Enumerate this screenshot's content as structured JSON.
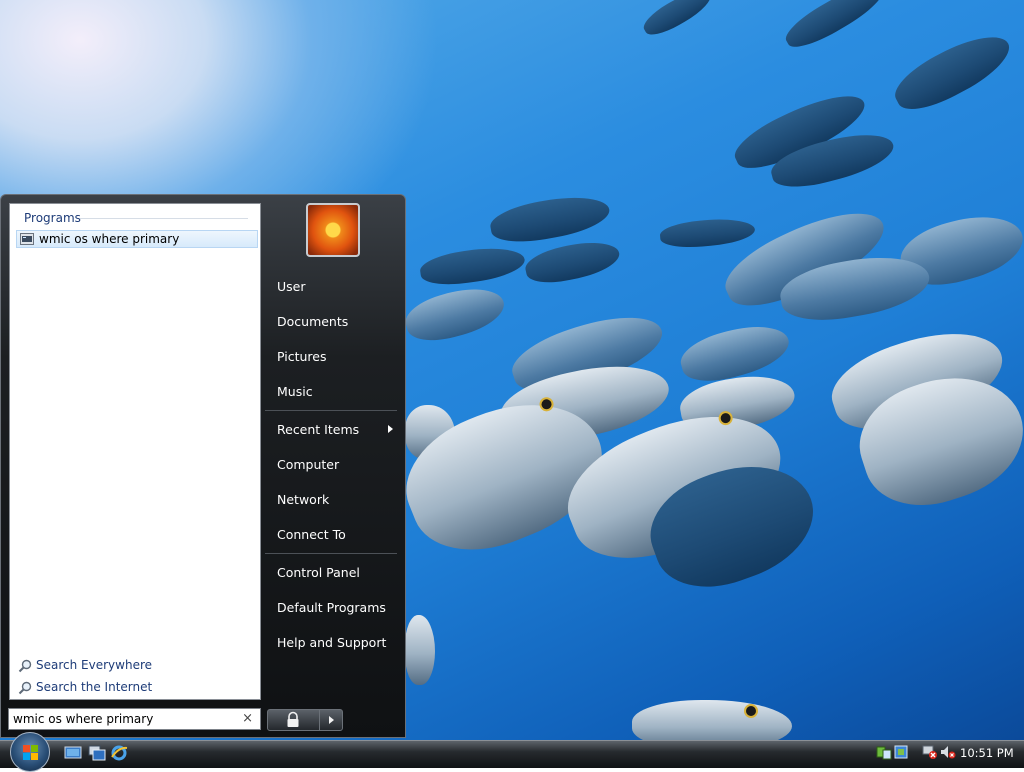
{
  "start_menu": {
    "programs_header": "Programs",
    "search_result": "wmic os where primary",
    "search_links": [
      "Search Everywhere",
      "Search the Internet"
    ],
    "search_box_value": "wmic os where primary",
    "clear_symbol": "×",
    "right_column": [
      "User",
      "Documents",
      "Pictures",
      "Music",
      "Recent Items",
      "Computer",
      "Network",
      "Connect To",
      "Control Panel",
      "Default Programs",
      "Help and Support"
    ]
  },
  "taskbar": {
    "clock": "10:51 PM"
  },
  "colors": {
    "desktop_blue": "#1f7fd6",
    "menu_black": "#0f1113",
    "link_blue": "#1e3c78",
    "selection_bg": "#d7eafb"
  },
  "icons": {
    "start_orb": "windows-flag-icon",
    "quicklaunch": [
      "show-desktop-icon",
      "switch-windows-icon",
      "internet-explorer-icon"
    ],
    "tray": [
      "network-sync-icon",
      "network-disconnected-icon",
      "volume-muted-icon"
    ],
    "power": [
      "lock-icon",
      "power-options-arrow-icon"
    ]
  }
}
